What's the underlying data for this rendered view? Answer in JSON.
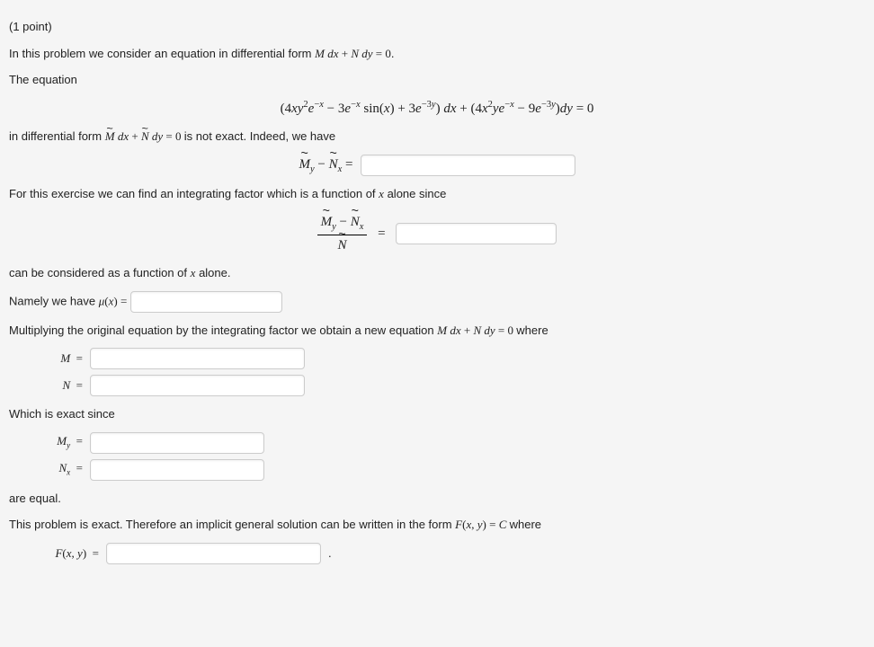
{
  "header": {
    "points": "(1 point)",
    "intro": "In this problem we consider an equation in differential form",
    "intro_math": "M dx + N dy = 0",
    "intro_end": "."
  },
  "para1": "The equation",
  "display_eq": "(4xy²e⁻ˣ − 3e⁻ˣ sin(x) + 3e⁻³ʸ) dx + (4x²ye⁻ˣ − 9e⁻³ʸ)dy = 0",
  "para2_a": "in differential form",
  "para2_math": "M̃ dx + Ñ dy = 0",
  "para2_b": "is not exact. Indeed, we have",
  "diff_label_pre": "M̃",
  "diff_label_sub1": "y",
  "diff_label_mid": " − ",
  "diff_label_pre2": "Ñ",
  "diff_label_sub2": "x",
  "eq": " = ",
  "para3_a": "For this exercise we can find an integrating factor which is a function of",
  "para3_x": "x",
  "para3_b": "alone since",
  "frac_num": "M̃y − Ñx",
  "frac_den": "Ñ",
  "para4_a": "can be considered as a function of",
  "para4_b": "alone.",
  "mu_label_a": "Namely we have",
  "mu_label_math": "μ(x) = ",
  "para5_a": "Multiplying the original equation by the integrating factor we obtain a new equation",
  "para5_math": "M dx + N dy = 0",
  "para5_b": "where",
  "M_label": "M =",
  "N_label": "N =",
  "para6": "Which is exact since",
  "My_label": "Mᵧ =",
  "Nx_label": "Nₓ =",
  "para7": "are equal.",
  "para8_a": "This problem is exact. Therefore an implicit general solution can be written in the form",
  "para8_math": "F(x, y) = C",
  "para8_b": "where",
  "F_label": "F(x, y) = ",
  "period": "."
}
